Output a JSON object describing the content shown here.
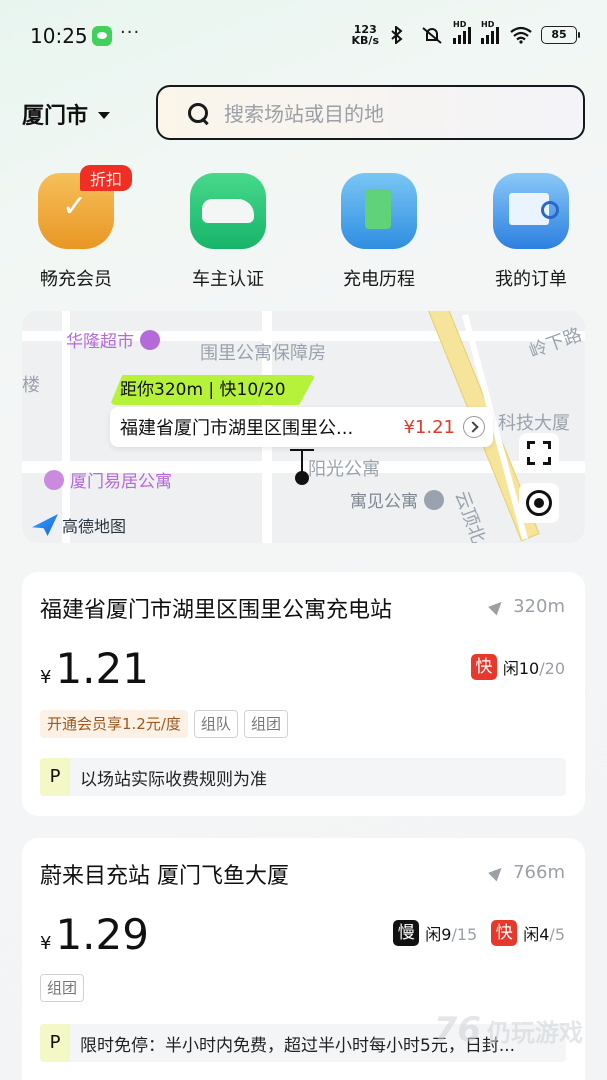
{
  "status_bar": {
    "time": "10:25",
    "dots": "···",
    "net_speed_top": "123",
    "net_speed_bottom": "KB/s",
    "hd1": "HD",
    "hd2": "HD",
    "battery": "85"
  },
  "header": {
    "city": "厦门市",
    "search_placeholder": "搜索场站或目的地"
  },
  "quick_actions": [
    {
      "label": "畅充会员",
      "badge": "折扣",
      "icon": "member-crown-icon"
    },
    {
      "label": "车主认证",
      "icon": "car-icon"
    },
    {
      "label": "充电历程",
      "icon": "charging-history-icon"
    },
    {
      "label": "我的订单",
      "icon": "order-list-icon"
    }
  ],
  "map": {
    "labels": {
      "hualong": "华隆超市",
      "weili_housing": "围里公寓保障房",
      "lingxia": "岭下路",
      "lou": "楼",
      "keji": "科技大厦",
      "yijv": "厦门易居公寓",
      "yangguang": "阳光公寓",
      "yujian": "寓见公寓",
      "yunding": "云顶北"
    },
    "distance_tag": "距你320m | 快10/20",
    "bubble_name": "福建省厦门市湖里区围里公...",
    "bubble_price": "¥1.21",
    "logo_text": "高德地图"
  },
  "stations": [
    {
      "name": "福建省厦门市湖里区围里公寓充电站",
      "distance": "320m",
      "currency": "¥",
      "price": "1.21",
      "availability": [
        {
          "type": "快",
          "idle_label": "闲10",
          "total": "/20",
          "color": "#e8372b"
        }
      ],
      "tags": [
        "开通会员享1.2元/度",
        "组队",
        "组团"
      ],
      "parking_label": "P",
      "parking_text": "以场站实际收费规则为准"
    },
    {
      "name": "蔚来目充站 厦门飞鱼大厦",
      "distance": "766m",
      "currency": "¥",
      "price": "1.29",
      "availability": [
        {
          "type": "慢",
          "idle_label": "闲9",
          "total": "/15",
          "color": "#111111"
        },
        {
          "type": "快",
          "idle_label": "闲4",
          "total": "/5",
          "color": "#e8372b"
        }
      ],
      "tags": [
        "组团"
      ],
      "parking_label": "P",
      "parking_text": "限时免停：半小时内免费，超过半小时每小时5元，日封..."
    }
  ],
  "watermark": {
    "logo": "76",
    "text": "仍玩游戏"
  },
  "colors": {
    "accent_green": "#b6f23a",
    "price_red": "#e23a2a",
    "fast_red": "#e8372b"
  }
}
